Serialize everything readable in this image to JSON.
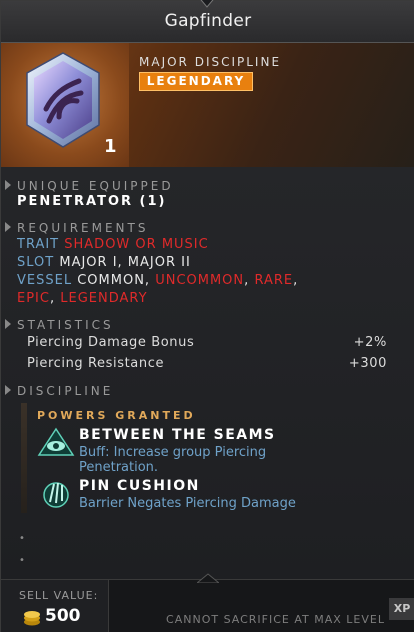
{
  "item": {
    "name": "Gapfinder",
    "category": "MAJOR DISCIPLINE",
    "rarity": "LEGENDARY",
    "tier": "1",
    "colors": {
      "rarity": "#e8800f",
      "accent_red": "#e02a2a",
      "accent_blue": "#6fa2c9"
    }
  },
  "sections": {
    "unique": {
      "heading": "UNIQUE EQUIPPED",
      "value": "PENETRATOR (1)"
    },
    "requirements": {
      "heading": "REQUIREMENTS",
      "trait_label": "TRAIT",
      "trait_value": "SHADOW OR MUSIC",
      "slot_label": "SLOT",
      "slot_value": "MAJOR I, MAJOR II",
      "vessel_label": "VESSEL",
      "vessel_common": "COMMON",
      "vessel_uncommon": "UNCOMMON",
      "vessel_rare": "RARE",
      "vessel_epic": "EPIC",
      "vessel_legendary": "LEGENDARY",
      "comma": ","
    },
    "statistics": {
      "heading": "STATISTICS",
      "rows": [
        {
          "name": "Piercing Damage Bonus",
          "value": "+2%"
        },
        {
          "name": "Piercing Resistance",
          "value": "+300"
        }
      ]
    },
    "discipline": {
      "heading": "DISCIPLINE",
      "powers_heading": "POWERS GRANTED",
      "powers": [
        {
          "name": "BETWEEN THE SEAMS",
          "desc": "Buff: Increase group Piercing Penetration.",
          "icon": "eye-pyramid-icon"
        },
        {
          "name": "PIN CUSHION",
          "desc": "Barrier Negates Piercing Damage",
          "icon": "pin-cushion-icon"
        }
      ]
    }
  },
  "footer": {
    "sell_label": "SELL VALUE:",
    "sell_value": "500",
    "sacrifice_text": "CANNOT SACRIFICE AT MAX LEVEL",
    "xp_label": "XP"
  }
}
